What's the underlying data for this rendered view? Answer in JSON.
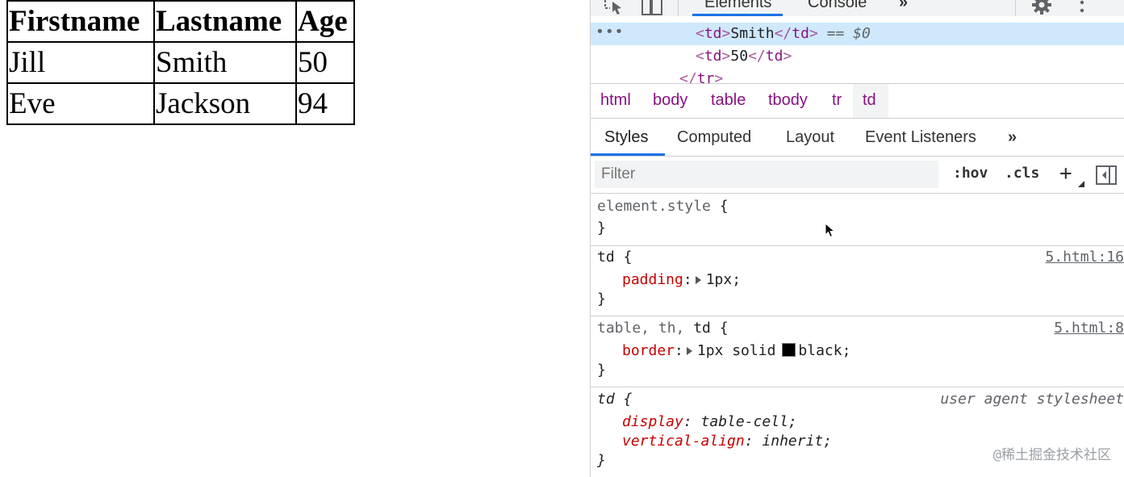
{
  "page": {
    "table": {
      "headers": [
        "Firstname",
        "Lastname",
        "Age"
      ],
      "rows": [
        [
          "Jill",
          "Smith",
          "50"
        ],
        [
          "Eve",
          "Jackson",
          "94"
        ]
      ]
    }
  },
  "devtools": {
    "top_tabs": {
      "elements": "Elements",
      "console": "Console",
      "more": "»"
    },
    "icons": [
      "inspect-element-icon",
      "device-toggle-icon",
      "gear-icon",
      "kebab-menu-icon"
    ],
    "dom_tree": {
      "ellipsis": "•••",
      "selected_row": {
        "open_tag": "td",
        "text": "Smith",
        "close_tag": "td",
        "marker": "== $0"
      },
      "row2": {
        "open_tag": "td",
        "text": "50",
        "close_tag": "td"
      },
      "row3": {
        "close_tag": "tr"
      }
    },
    "breadcrumbs": [
      "html",
      "body",
      "table",
      "tbody",
      "tr",
      "td"
    ],
    "sub_tabs": {
      "styles": "Styles",
      "computed": "Computed",
      "layout": "Layout",
      "event_listeners": "Event Listeners",
      "more": "»"
    },
    "filter": {
      "placeholder": "Filter",
      "hov": ":hov",
      "cls": ".cls",
      "add": "+"
    },
    "rules": {
      "element_style": {
        "selector": "element.style"
      },
      "td_rule": {
        "selector": "td",
        "source": "5.html:16",
        "prop": "padding",
        "value": "1px"
      },
      "border_rule": {
        "selector_dim": "table, th, ",
        "selector": "td",
        "source": "5.html:8",
        "prop": "border",
        "value_a": "1px solid",
        "value_b": "black"
      },
      "ua_rule": {
        "selector": "td",
        "source": "user agent stylesheet",
        "prop1": "display",
        "value1": "table-cell",
        "prop2": "vertical-align",
        "value2": "inherit"
      }
    },
    "watermark": "@稀土掘金技术社区"
  }
}
